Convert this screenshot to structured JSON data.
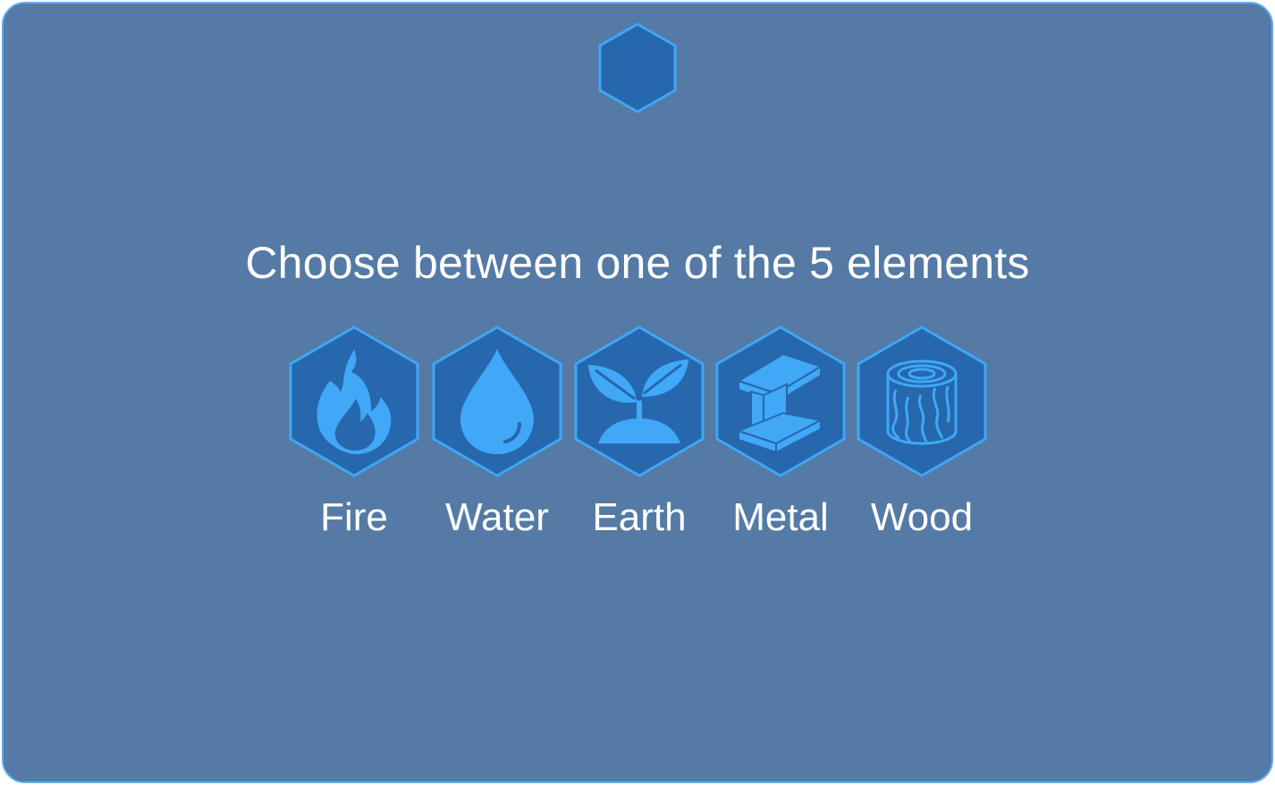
{
  "colors": {
    "panel_bg": "#557aa6",
    "panel_border": "#5aaef0",
    "hex_fill": "#2767ae",
    "hex_stroke": "#3ea7f5",
    "icon_fill": "#40a8f6",
    "text": "#ffffff"
  },
  "title": "Choose between one of the 5 elements",
  "elements": [
    {
      "label": "Fire",
      "icon": "flame-icon"
    },
    {
      "label": "Water",
      "icon": "water-drop-icon"
    },
    {
      "label": "Earth",
      "icon": "sprout-icon"
    },
    {
      "label": "Metal",
      "icon": "steel-beam-icon"
    },
    {
      "label": "Wood",
      "icon": "log-icon"
    }
  ]
}
